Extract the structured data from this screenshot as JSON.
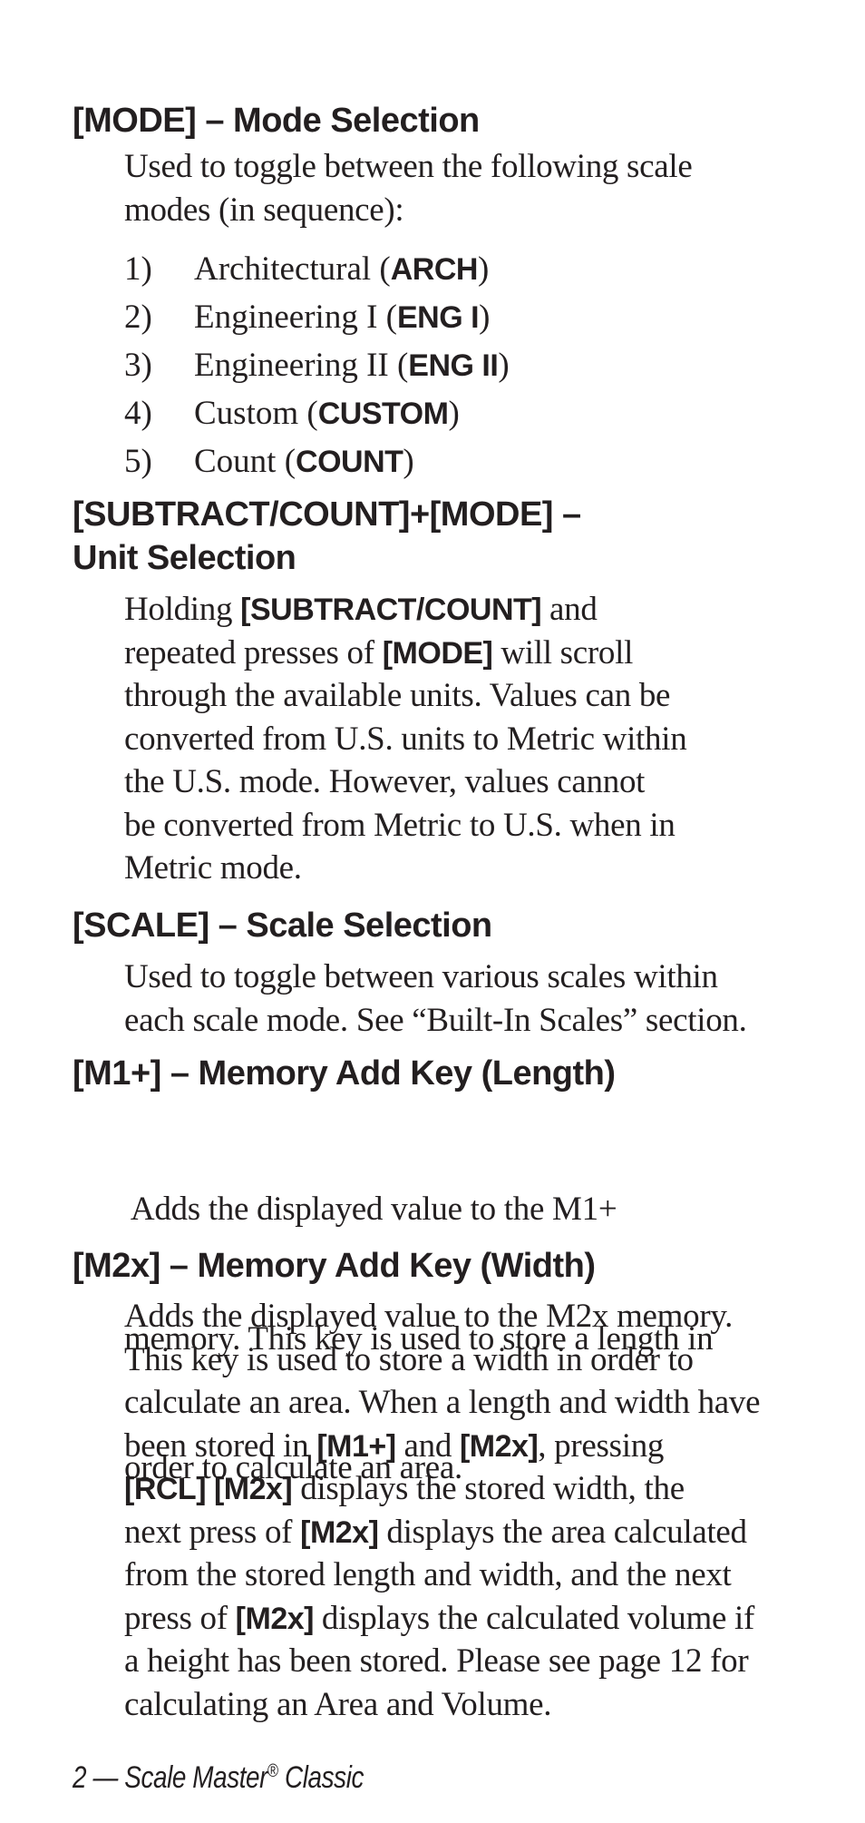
{
  "sections": [
    {
      "heading": "[MODE] – Mode Selection",
      "body_lines": [
        "Used to toggle between the following scale",
        "modes (in sequence):"
      ],
      "list": [
        {
          "num": "1)",
          "text": "Architectural (",
          "bold": "ARCH",
          "after": ")"
        },
        {
          "num": "2)",
          "text": "Engineering I (",
          "bold": "ENG I",
          "after": ")"
        },
        {
          "num": "3)",
          "text": "Engineering II (",
          "bold": "ENG II",
          "after": ")"
        },
        {
          "num": "4)",
          "text": "Custom (",
          "bold": "CUSTOM",
          "after": ")"
        },
        {
          "num": "5)",
          "text": "Count (",
          "bold": "COUNT",
          "after": ")"
        }
      ]
    },
    {
      "heading_lines": [
        "[SUBTRACT/COUNT]+[MODE] –",
        "Unit Selection"
      ],
      "body": {
        "l1_pre": "Holding ",
        "l1_bold": "[SUBTRACT/COUNT]",
        "l1_post": " and",
        "l2_pre": "repeated presses of ",
        "l2_bold": "[MODE]",
        "l2_post": " will scroll",
        "l3": "through the available units. Values can be",
        "l4": "converted from U.S. units to Metric within",
        "l5": "the U.S. mode. However, values cannot",
        "l6": "be converted from Metric to U.S. when in",
        "l7": "Metric mode."
      }
    },
    {
      "heading": "[SCALE] – Scale Selection",
      "body_lines": [
        "Used to toggle between various scales within",
        "each scale mode. See “Built-In Scales” section."
      ]
    },
    {
      "heading": "[M1+] – Memory Add Key (Length)",
      "body_lines": [
        " Adds the displayed value to the M1+",
        "memory. This key is used to store a length in",
        "order to calculate an area."
      ]
    },
    {
      "heading": "[M2x] – Memory Add Key (Width)",
      "body": {
        "l1": "Adds the displayed value to the M2x memory.",
        "l2": "This key is used to store a width in order to",
        "l3": "calculate an area. When a length and width have",
        "l4_pre": "been stored in ",
        "l4_b1": "[M1+]",
        "l4_mid": " and ",
        "l4_b2": "[M2x]",
        "l4_post": ", pressing",
        "l5_b1": "[RCL] [M2x]",
        "l5_post": " displays the stored width, the",
        "l6_pre": "next press of ",
        "l6_b1": "[M2x]",
        "l6_post": " displays the area calculated",
        "l7": "from the stored length and width, and the next",
        "l8_pre": "press of ",
        "l8_b1": "[M2x]",
        "l8_post": " displays the calculated volume if",
        "l9": "a height has been stored. Please see page 12 for",
        "l10": "calculating an Area and Volume."
      }
    }
  ],
  "footer": {
    "page_number": "2",
    "dash": " — ",
    "product": "Scale Master",
    "reg_mark": "®",
    "product_suffix": " Classic"
  }
}
